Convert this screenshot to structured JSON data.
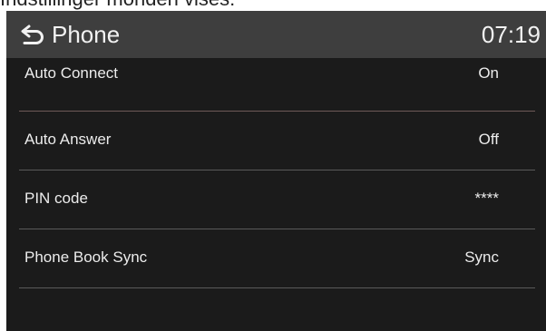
{
  "caption": "Indstillinger mohden vises:",
  "header": {
    "back_icon": "back-arrow-icon",
    "title": "Phone",
    "time": "07:19"
  },
  "settings": [
    {
      "label": "Auto Connect",
      "value": "On"
    },
    {
      "label": "Auto Answer",
      "value": "Off"
    },
    {
      "label": "PIN code",
      "value": "****"
    },
    {
      "label": "Phone Book Sync",
      "value": "Sync"
    }
  ],
  "colors": {
    "header_bg": "#3e3e3e",
    "screen_bg": "#1b1b1b",
    "text": "#ececec",
    "divider": "#5a5a5a"
  }
}
